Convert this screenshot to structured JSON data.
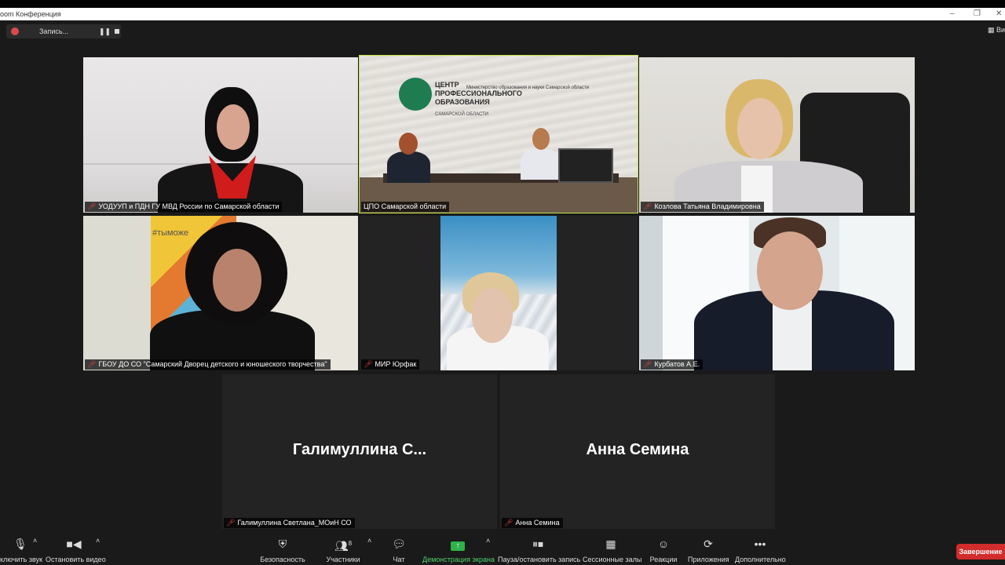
{
  "window": {
    "title": "oom Конференция"
  },
  "recording": {
    "label": "Запись...",
    "pause_glyph": "❚❚"
  },
  "view_button": "Вид",
  "tiles": [
    {
      "name": "УОДУУП и ПДН ГУ МВД России по Самарской области"
    },
    {
      "name": "ЦПО Самарской области",
      "banner_org": "ЦЕНТР ПРОФЕССИОНАЛЬНОГО ОБРАЗОВАНИЯ",
      "banner_region": "САМАРСКОЙ ОБЛАСТИ",
      "banner_ministry": "Министерство образования и науки Самарской области"
    },
    {
      "name": "Козлова Татьяна Владимировна"
    },
    {
      "name": "ГБОУ ДО СО \"Самарский Дворец детского и юношеского творчества\"",
      "wall_text": "#тыможе"
    },
    {
      "name": "МИР Юрфак"
    },
    {
      "name": "Курбатов А.Е."
    },
    {
      "name": "Галимуллина Светлана_МОиН СО",
      "display": "Галимуллина  С..."
    },
    {
      "name": "Анна Семина",
      "display": "Анна Семина"
    }
  ],
  "toolbar": {
    "mute": "ключить звук",
    "video": "Остановить видео",
    "security": "Безопасность",
    "participants": "Участники",
    "participants_count": "8",
    "chat": "Чат",
    "share": "Демонстрация экрана",
    "record": "Пауза/остановить запись",
    "breakout": "Сессионные залы",
    "reactions": "Реакции",
    "apps": "Приложения",
    "more": "Дополнительно",
    "end": "Завершение"
  },
  "colors": {
    "active_border": "#c3e34a",
    "share_green": "#2fb24a",
    "end_red": "#d22c2c"
  }
}
